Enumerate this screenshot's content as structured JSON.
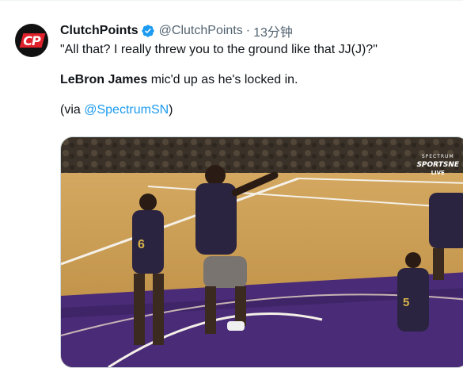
{
  "tweet": {
    "author_name": "ClutchPoints",
    "handle": "@ClutchPoints",
    "separator": "·",
    "time": "13分钟",
    "avatar_text": "CP",
    "line1": "\"All that? I really threw you to the ground like that JJ(J)?\"",
    "line2_bold": "LeBron James",
    "line2_rest": " mic'd up as he's locked in.",
    "line3_prefix": "(via ",
    "line3_link": "@SpectrumSN",
    "line3_suffix": ")"
  },
  "media": {
    "watermark_top": "SPECTRUM",
    "watermark_mid": "SPORTSNE",
    "watermark_bot": "LIVE"
  },
  "colors": {
    "link": "#1d9bf0",
    "verified": "#1d9bf0",
    "court": "#c89a4e",
    "paint": "#4a2b78",
    "lakers_jersey": "#2a2440"
  },
  "icons": {
    "verified": "verified-badge-icon"
  }
}
